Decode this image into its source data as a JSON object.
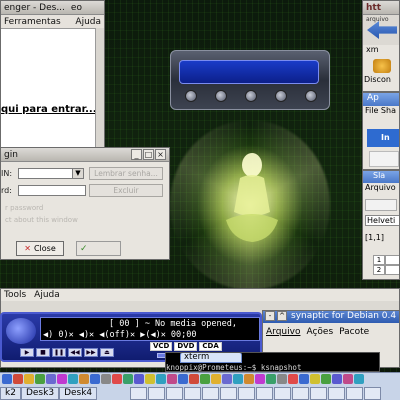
{
  "left_window": {
    "title": "eo",
    "subtitle": "enger - Des...",
    "menu": [
      "Ferramentas",
      "Ajuda"
    ],
    "link_text": "qui para entrar..."
  },
  "login_dialog": {
    "title": "gin",
    "label_user": "IN:",
    "label_password": "rd:",
    "btn_connect": "Lembrar senha...",
    "btn_delete": "Excluir",
    "ghost_line1": "r password",
    "ghost_line2": "ct about this window",
    "btn_close": "Close",
    "btn_ok_mark": "✓"
  },
  "browser": {
    "title": "htt",
    "tab_label": "xm",
    "disconnect_label": "Discon",
    "small_label": "arquivo"
  },
  "apps_window": {
    "title": "Ap",
    "menu": "File Sha",
    "info_label": "In"
  },
  "calc_window": {
    "title": "Sla",
    "menu": "Arquivo",
    "font": "Helveti",
    "cell_ref": "[1,1]",
    "row1": "1",
    "row2": "2"
  },
  "lower_window": {
    "menu": [
      "Tools",
      "Ajuda"
    ]
  },
  "xmms": {
    "lcd_line1": "[ 00 ] ~ No media opened,",
    "lcd_line2": "◀)  0)✕ ◀)✕  ◀(off)✕  ▶(◀)✕       00;00",
    "badges": [
      "VCD",
      "DVD",
      "CDA"
    ]
  },
  "synaptic": {
    "title": "synaptic for Debian 0.4",
    "menu": [
      "Arquivo",
      "Ações",
      "Pacote"
    ]
  },
  "xterm": {
    "tab_label": "xterm",
    "prompt": "knoppix@Prometeus:~$ ksnapshot"
  },
  "taskbar": {
    "desks": [
      "k2",
      "Desk3",
      "Desk4"
    ]
  },
  "colors": {
    "desktop_green": "#12260f",
    "xmms_blue": "#1a2aa0",
    "titlebar_blue": "#4a78c8"
  }
}
